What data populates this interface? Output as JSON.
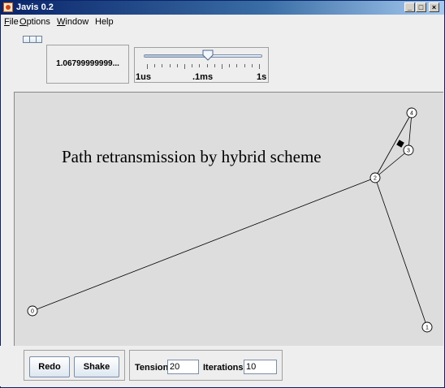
{
  "window": {
    "title": "Javis 0.2",
    "minimize_glyph": "_",
    "maximize_glyph": "□",
    "close_glyph": "×"
  },
  "menu": {
    "file": {
      "mnemonic": "F",
      "rest": "ile"
    },
    "options": {
      "mnemonic": "O",
      "rest": "ptions"
    },
    "window": {
      "mnemonic": "W",
      "rest": "indow"
    },
    "help": {
      "label": "Help"
    }
  },
  "toolbar": {
    "time_value": "1.06799999999...",
    "slider": {
      "labels": [
        "1us",
        ".1ms",
        "1s"
      ],
      "value_fraction": 0.54
    }
  },
  "canvas": {
    "annotation": "Path retransmission by hybrid scheme",
    "nodes": [
      {
        "id": "0",
        "label": "0"
      },
      {
        "id": "1",
        "label": "1"
      },
      {
        "id": "2",
        "label": "2"
      },
      {
        "id": "3",
        "label": "3"
      },
      {
        "id": "4",
        "label": "4"
      }
    ],
    "edges": [
      [
        "0",
        "2"
      ],
      [
        "2",
        "1"
      ],
      [
        "2",
        "3"
      ],
      [
        "2",
        "4"
      ],
      [
        "3",
        "4"
      ]
    ],
    "packet": {
      "edge": [
        "3",
        "4"
      ],
      "shape": "black-diamond"
    }
  },
  "controls": {
    "redo_label": "Redo",
    "shake_label": "Shake",
    "tension_label": "Tension",
    "tension_value": "20",
    "iterations_label": "Iterations",
    "iterations_value": "10"
  }
}
